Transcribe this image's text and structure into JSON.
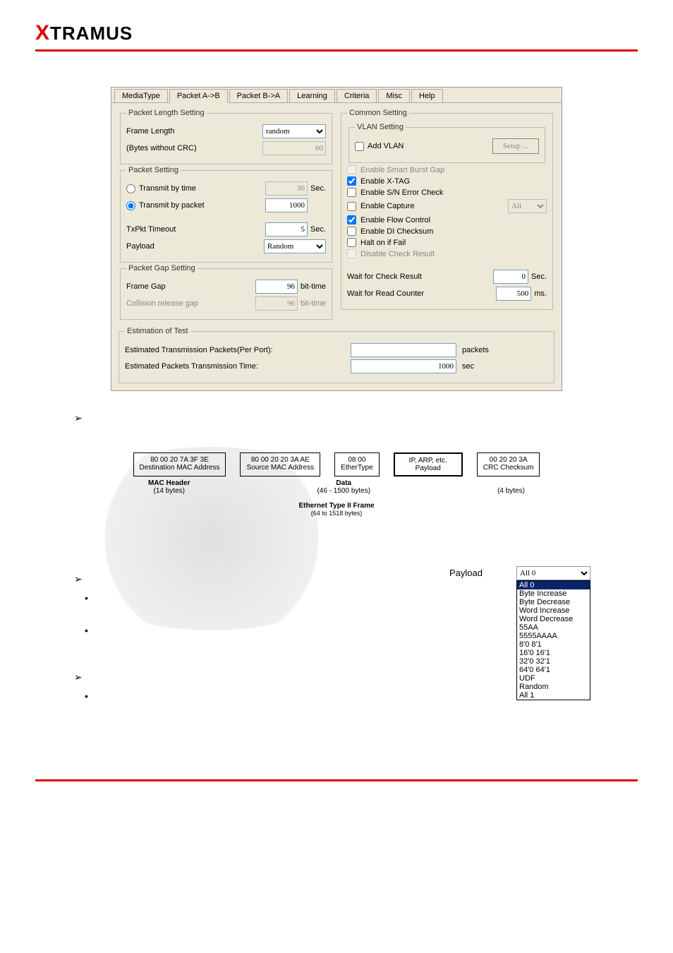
{
  "logo": "TRAMUS",
  "tabs": [
    "MediaType",
    "Packet A->B",
    "Packet B->A",
    "Learning",
    "Criteria",
    "Misc",
    "Help"
  ],
  "pls": {
    "legend": "Packet Length Setting",
    "frame": "Frame Length",
    "frame_sel": "random",
    "bytes_label": "(Bytes without CRC)",
    "bytes_val": "60"
  },
  "ps": {
    "legend": "Packet Setting",
    "r1": "Transmit by time",
    "r1v": "30",
    "r1u": "Sec.",
    "r2": "Transmit by packet",
    "r2v": "1000",
    "to": "TxPkt Timeout",
    "tov": "5",
    "tou": "Sec.",
    "pl": "Payload",
    "plv": "Random"
  },
  "pgs": {
    "legend": "Packet Gap Setting",
    "fg": "Frame Gap",
    "fgv": "96",
    "fgu": "bit-time",
    "cr": "Collision release gap",
    "crv": "96",
    "cru": "bit-time"
  },
  "cs": {
    "legend": "Common Setting"
  },
  "vlan": {
    "legend": "VLAN Setting",
    "add": "Add VLAN",
    "setup": "Setup ..."
  },
  "chk": {
    "c1": "Enable Smart Burst Gap",
    "c2": "Enable X-TAG",
    "c3": "Enable S/N Error Check",
    "c4": "Enable Capture",
    "c4v": "All",
    "c5": "Enable Flow Control",
    "c6": "Enable DI Checksum",
    "c7": "Halt on if Fail",
    "c8": "Disable Check Result"
  },
  "wait": {
    "w1": "Wait for Check Result",
    "w1v": "0",
    "w1u": "Sec.",
    "w2": "Wait for Read Counter",
    "w2v": "500",
    "w2u": "ms."
  },
  "est": {
    "legend": "Estimation of Test",
    "e1": "Estimated Transmission Packets(Per Port):",
    "e1u": "packets",
    "e2": "Estimated Packets Transmission Time:",
    "e2v": "1000",
    "e2u": "sec"
  },
  "frame": {
    "b1a": "80 00 20 7A 3F 3E",
    "b1b": "Destination MAC Address",
    "b2a": "80 00 20 20 3A AE",
    "b2b": "Source MAC Address",
    "b3a": "08 00",
    "b3b": "EtherType",
    "b4a": "IP, ARP, etc.",
    "b4b": "Payload",
    "b5a": "00 20 20 3A",
    "b5b": "CRC Checksum",
    "mh1": "MAC Header",
    "mh2": "(14 bytes)",
    "d1": "Data",
    "d2": "(46 - 1500 bytes)",
    "c2": "(4 bytes)",
    "cap1": "Ethernet Type II Frame",
    "cap2": "(64 to 1518 bytes)"
  },
  "payload": {
    "label": "Payload",
    "sel": "All 0",
    "opts": [
      "All 0",
      "Byte Increase",
      "Byte Decrease",
      "Word Increase",
      "Word Decrease",
      "55AA",
      "5555AAAA",
      "8'0 8'1",
      "16'0 16'1",
      "32'0 32'1",
      "64'0 64'1",
      "UDF",
      "Random",
      "All 1"
    ]
  }
}
